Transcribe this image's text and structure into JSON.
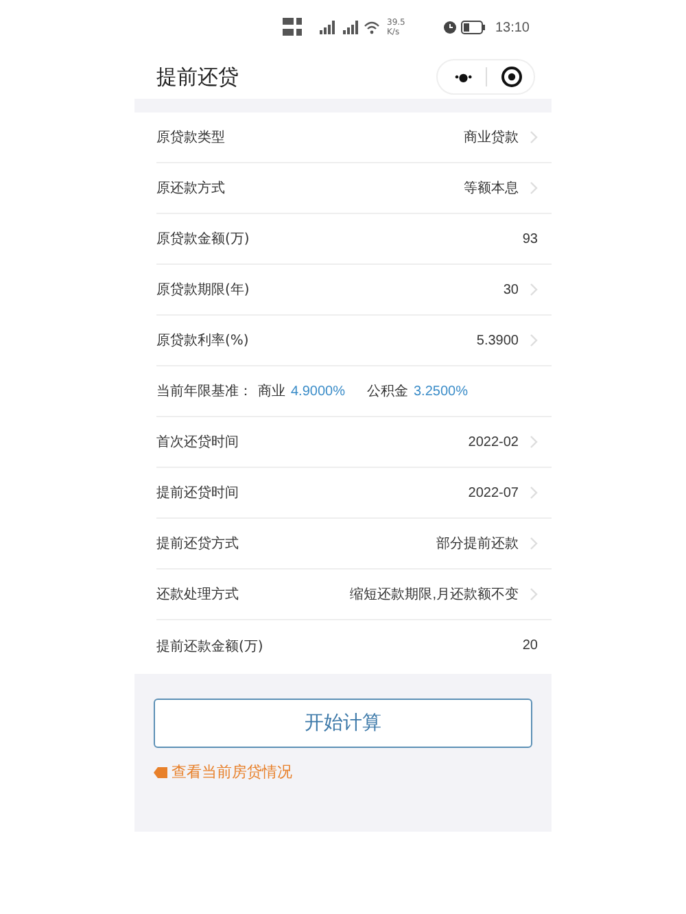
{
  "status_bar": {
    "net_speed": "39.5",
    "net_unit": "K/s",
    "time": "13:10"
  },
  "header": {
    "title": "提前还贷",
    "more_label": "•●•"
  },
  "rows": [
    {
      "kind": "select",
      "label": "原贷款类型",
      "value": "商业贷款"
    },
    {
      "kind": "select",
      "label": "原还款方式",
      "value": "等额本息"
    },
    {
      "kind": "input",
      "label": "原贷款金额(万)",
      "value": "93"
    },
    {
      "kind": "select",
      "label": "原贷款期限(年)",
      "value": "30"
    },
    {
      "kind": "select",
      "label": "原贷款利率(%)",
      "value": "5.3900"
    },
    {
      "kind": "note",
      "label": "当前年限基准：",
      "parts": [
        {
          "name": "商业",
          "rate": "4.9000%"
        },
        {
          "name": "公积金",
          "rate": "3.2500%"
        }
      ]
    },
    {
      "kind": "select",
      "label": "首次还贷时间",
      "value": "2022-02"
    },
    {
      "kind": "select",
      "label": "提前还贷时间",
      "value": "2022-07"
    },
    {
      "kind": "select",
      "label": "提前还贷方式",
      "value": "部分提前还款"
    },
    {
      "kind": "select",
      "label": "还款处理方式",
      "value": "缩短还款期限,月还款额不变"
    },
    {
      "kind": "input",
      "label": "提前还款金额(万)",
      "value": "20"
    }
  ],
  "button": "开始计算",
  "link": "查看当前房贷情况"
}
